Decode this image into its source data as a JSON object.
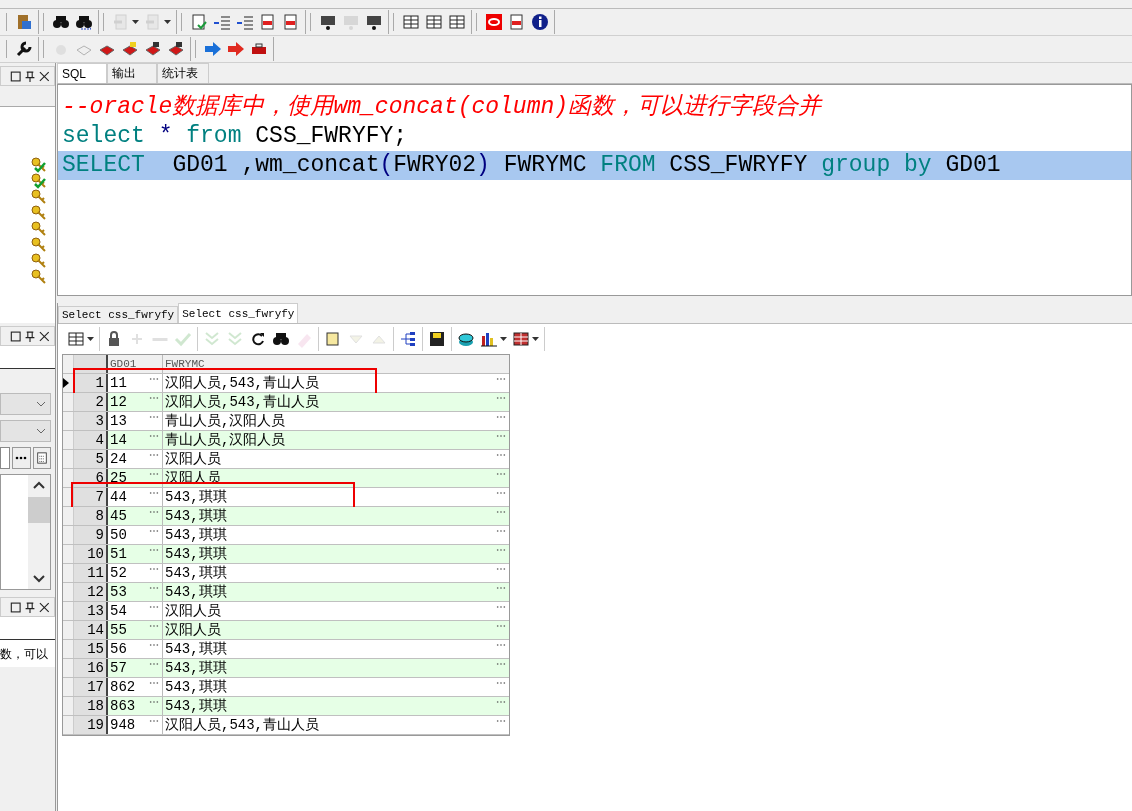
{
  "toolbars": [
    [
      [
        {
          "kind": "clipboard",
          "disabled": false
        }
      ],
      [
        {
          "kind": "binoculars",
          "disabled": false
        },
        {
          "kind": "find-next",
          "disabled": false
        }
      ],
      [
        {
          "kind": "undo",
          "disabled": true,
          "dropdown": true
        },
        {
          "kind": "redo",
          "disabled": true,
          "dropdown": true
        }
      ],
      [
        {
          "kind": "document-check",
          "disabled": false
        },
        {
          "kind": "indent",
          "disabled": false
        },
        {
          "kind": "outdent",
          "disabled": false
        },
        {
          "kind": "document-arrow",
          "disabled": false
        },
        {
          "kind": "document-arrow",
          "disabled": false
        }
      ],
      [
        {
          "kind": "projector",
          "disabled": false
        },
        {
          "kind": "projector",
          "disabled": true
        },
        {
          "kind": "projector",
          "disabled": false
        }
      ],
      [
        {
          "kind": "windows",
          "disabled": false
        },
        {
          "kind": "form",
          "disabled": false
        },
        {
          "kind": "columns",
          "disabled": false
        }
      ],
      [
        {
          "kind": "oval",
          "disabled": false
        },
        {
          "kind": "document",
          "disabled": false
        },
        {
          "kind": "info",
          "disabled": false
        }
      ]
    ],
    [
      [
        {
          "kind": "wrench",
          "disabled": false
        }
      ],
      [
        {
          "kind": "gear",
          "disabled": true
        },
        {
          "kind": "book",
          "disabled": true
        },
        {
          "kind": "book",
          "disabled": false
        },
        {
          "kind": "book-folder",
          "disabled": false
        },
        {
          "kind": "book-clip",
          "disabled": false
        },
        {
          "kind": "book-brush",
          "disabled": false
        }
      ],
      [
        {
          "kind": "arrow-right",
          "disabled": false
        },
        {
          "kind": "go-arrow",
          "disabled": false
        },
        {
          "kind": "toolbox",
          "disabled": false
        }
      ]
    ]
  ],
  "left_panel": {
    "keys": [
      {
        "checked": true
      },
      {
        "checked": true
      },
      {
        "checked": false
      },
      {
        "checked": false
      },
      {
        "checked": false
      },
      {
        "checked": false
      },
      {
        "checked": false
      },
      {
        "checked": false
      }
    ],
    "note_text": "数，可以"
  },
  "editor_tabs": [
    {
      "label": "SQL",
      "selected": true
    },
    {
      "label": "输出",
      "selected": false
    },
    {
      "label": "统计表",
      "selected": false
    }
  ],
  "code_lines": [
    {
      "selected": false,
      "tokens": [
        {
          "kind": "comment",
          "text": "--oracle数据库中，使用wm_concat(column)函数，可以进行字段合并"
        }
      ]
    },
    {
      "selected": false,
      "tokens": [
        {
          "kind": "keyword",
          "text": "select"
        },
        {
          "kind": "operator",
          "text": " * "
        },
        {
          "kind": "keyword",
          "text": "from"
        },
        {
          "kind": "plain",
          "text": " CSS_FWRYFY;"
        }
      ]
    },
    {
      "selected": true,
      "tokens": [
        {
          "kind": "keyword",
          "text": "SELECT"
        },
        {
          "kind": "plain",
          "text": "  GD01 ,wm_concat"
        },
        {
          "kind": "operator",
          "text": "("
        },
        {
          "kind": "plain",
          "text": "FWRY02"
        },
        {
          "kind": "operator",
          "text": ")"
        },
        {
          "kind": "plain",
          "text": " FWRYMC "
        },
        {
          "kind": "keyword",
          "text": "FROM"
        },
        {
          "kind": "plain",
          "text": " CSS_FWRYFY "
        },
        {
          "kind": "keyword",
          "text": "group by"
        },
        {
          "kind": "plain",
          "text": " GD01"
        }
      ]
    }
  ],
  "result_tabs": [
    {
      "label": "Select css_fwryfy",
      "selected": false
    },
    {
      "label": "Select css_fwryfy",
      "selected": true
    }
  ],
  "grid_toolbar": [
    [
      {
        "kind": "grid",
        "disabled": false,
        "dropdown": true
      }
    ],
    [
      {
        "kind": "lock",
        "disabled": false
      },
      {
        "kind": "plus",
        "disabled": true
      },
      {
        "kind": "minus",
        "disabled": true
      },
      {
        "kind": "check",
        "disabled": true
      }
    ],
    [
      {
        "kind": "chevrons-down",
        "disabled": true
      },
      {
        "kind": "chevrons-down",
        "disabled": true
      },
      {
        "kind": "refresh",
        "disabled": false
      },
      {
        "kind": "binoculars",
        "disabled": false
      },
      {
        "kind": "eraser",
        "disabled": true
      }
    ],
    [
      {
        "kind": "notes",
        "disabled": false
      },
      {
        "kind": "triangle-down",
        "disabled": true
      },
      {
        "kind": "triangle-up",
        "disabled": true
      }
    ],
    [
      {
        "kind": "tree",
        "disabled": false
      }
    ],
    [
      {
        "kind": "floppy",
        "disabled": false
      }
    ],
    [
      {
        "kind": "database",
        "disabled": false
      },
      {
        "kind": "bar-chart",
        "disabled": false,
        "dropdown": true
      },
      {
        "kind": "table",
        "disabled": false,
        "dropdown": true
      }
    ]
  ],
  "table": {
    "columns": [
      "GD01",
      "FWRYMC"
    ],
    "rows": [
      {
        "number": "1",
        "gd01": "11",
        "fwrymc": "汉阳人员,543,青山人员",
        "selected": true,
        "annotated": true
      },
      {
        "number": "2",
        "gd01": "12",
        "fwrymc": "汉阳人员,543,青山人员",
        "selected": false,
        "annotated": false
      },
      {
        "number": "3",
        "gd01": "13",
        "fwrymc": "青山人员,汉阳人员",
        "selected": false,
        "annotated": false
      },
      {
        "number": "4",
        "gd01": "14",
        "fwrymc": "青山人员,汉阳人员",
        "selected": false,
        "annotated": false
      },
      {
        "number": "5",
        "gd01": "24",
        "fwrymc": "汉阳人员",
        "selected": false,
        "annotated": false
      },
      {
        "number": "6",
        "gd01": "25",
        "fwrymc": "汉阳人员",
        "selected": false,
        "annotated": false
      },
      {
        "number": "7",
        "gd01": "44",
        "fwrymc": "543,琪琪",
        "selected": false,
        "annotated": true
      },
      {
        "number": "8",
        "gd01": "45",
        "fwrymc": "543,琪琪",
        "selected": false,
        "annotated": false
      },
      {
        "number": "9",
        "gd01": "50",
        "fwrymc": "543,琪琪",
        "selected": false,
        "annotated": false
      },
      {
        "number": "10",
        "gd01": "51",
        "fwrymc": "543,琪琪",
        "selected": false,
        "annotated": false
      },
      {
        "number": "11",
        "gd01": "52",
        "fwrymc": "543,琪琪",
        "selected": false,
        "annotated": false
      },
      {
        "number": "12",
        "gd01": "53",
        "fwrymc": "543,琪琪",
        "selected": false,
        "annotated": false
      },
      {
        "number": "13",
        "gd01": "54",
        "fwrymc": "汉阳人员",
        "selected": false,
        "annotated": false
      },
      {
        "number": "14",
        "gd01": "55",
        "fwrymc": "汉阳人员",
        "selected": false,
        "annotated": false
      },
      {
        "number": "15",
        "gd01": "56",
        "fwrymc": "543,琪琪",
        "selected": false,
        "annotated": false
      },
      {
        "number": "16",
        "gd01": "57",
        "fwrymc": "543,琪琪",
        "selected": false,
        "annotated": false
      },
      {
        "number": "17",
        "gd01": "862",
        "fwrymc": "543,琪琪",
        "selected": false,
        "annotated": false
      },
      {
        "number": "18",
        "gd01": "863",
        "fwrymc": "543,琪琪",
        "selected": false,
        "annotated": false
      },
      {
        "number": "19",
        "gd01": "948",
        "fwrymc": "汉阳人员,543,青山人员",
        "selected": false,
        "annotated": false
      }
    ]
  }
}
